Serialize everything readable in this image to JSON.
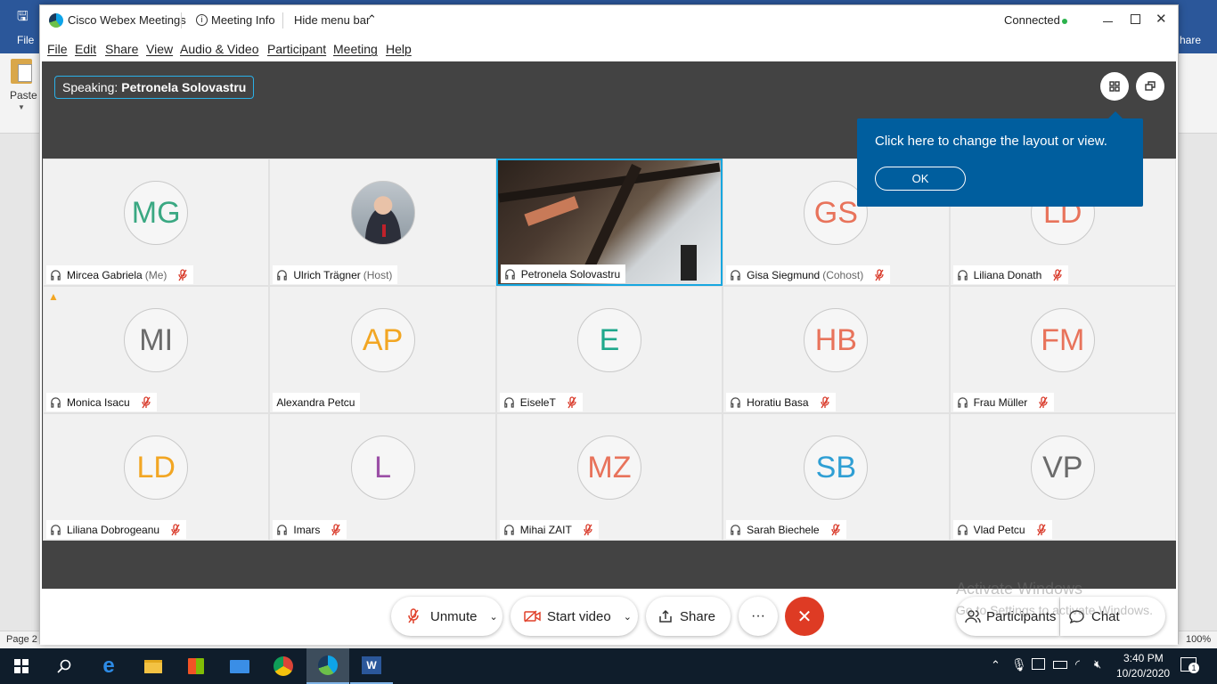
{
  "word": {
    "file_tab": "File",
    "share_tab": "hare",
    "paste_label": "Paste",
    "page_label": "Page 2",
    "zoom": "100%"
  },
  "window": {
    "app_title": "Cisco Webex Meetings",
    "meeting_info": "Meeting Info",
    "hide_menu": "Hide menu bar",
    "status": "Connected",
    "status_color": "#2bb24c"
  },
  "menu": [
    "File",
    "Edit",
    "Share",
    "View",
    "Audio & Video",
    "Participant",
    "Meeting",
    "Help"
  ],
  "speaking": {
    "label": "Speaking:",
    "name": "Petronela Solovastru"
  },
  "tooltip": {
    "text": "Click here to change the layout or view.",
    "ok": "OK"
  },
  "participants": [
    {
      "initials": "MG",
      "color": "#3aa882",
      "name": "Mircea Gabriela",
      "role": "(Me)",
      "muted": true,
      "type": "avatar"
    },
    {
      "initials": "",
      "color": "#888888",
      "name": "Ulrich Trägner",
      "role": "(Host)",
      "muted": false,
      "type": "photo"
    },
    {
      "initials": "",
      "color": "#888888",
      "name": "Petronela Solovastru",
      "role": "",
      "muted": false,
      "type": "video"
    },
    {
      "initials": "GS",
      "color": "#e8735b",
      "name": "Gisa Siegmund",
      "role": "(Cohost)",
      "muted": true,
      "type": "avatar"
    },
    {
      "initials": "LD",
      "color": "#e8735b",
      "name": "Liliana Donath",
      "role": "",
      "muted": true,
      "type": "avatar"
    },
    {
      "initials": "MI",
      "color": "#6b6b6b",
      "name": "Monica Isacu",
      "role": "",
      "muted": true,
      "type": "avatar",
      "warning": true
    },
    {
      "initials": "AP",
      "color": "#f2a623",
      "name": "Alexandra Petcu",
      "role": "",
      "muted": false,
      "type": "avatar",
      "no_headset": true
    },
    {
      "initials": "E",
      "color": "#1fa88c",
      "name": "EiseleT",
      "role": "",
      "muted": true,
      "type": "avatar"
    },
    {
      "initials": "HB",
      "color": "#e8735b",
      "name": "Horatiu Basa",
      "role": "",
      "muted": true,
      "type": "avatar"
    },
    {
      "initials": "FM",
      "color": "#e8735b",
      "name": "Frau Müller",
      "role": "",
      "muted": true,
      "type": "avatar"
    },
    {
      "initials": "LD",
      "color": "#f2a623",
      "name": "Liliana Dobrogeanu",
      "role": "",
      "muted": true,
      "type": "avatar"
    },
    {
      "initials": "L",
      "color": "#9b4fa6",
      "name": "Imars",
      "role": "",
      "muted": true,
      "type": "avatar"
    },
    {
      "initials": "MZ",
      "color": "#e8735b",
      "name": "Mihai ZAIT",
      "role": "",
      "muted": true,
      "type": "avatar"
    },
    {
      "initials": "SB",
      "color": "#2f9fd4",
      "name": "Sarah Biechele",
      "role": "",
      "muted": true,
      "type": "avatar"
    },
    {
      "initials": "VP",
      "color": "#6b6b6b",
      "name": "Vlad Petcu",
      "role": "",
      "muted": true,
      "type": "avatar"
    }
  ],
  "controls": {
    "unmute": "Unmute",
    "start_video": "Start video",
    "share": "Share",
    "more": "···",
    "participants": "Participants",
    "chat": "Chat"
  },
  "watermark": {
    "line1": "Activate Windows",
    "line2": "Go to Settings to activate Windows."
  },
  "taskbar": {
    "time": "3:40 PM",
    "date": "10/20/2020",
    "notifications": "1"
  }
}
